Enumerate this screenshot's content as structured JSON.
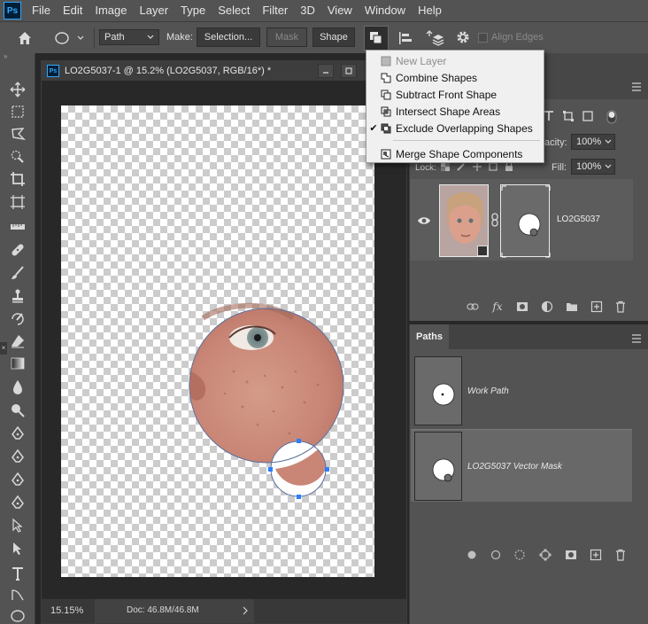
{
  "menubar": {
    "logo": "Ps",
    "items": [
      "File",
      "Edit",
      "Image",
      "Layer",
      "Type",
      "Select",
      "Filter",
      "3D",
      "View",
      "Window",
      "Help"
    ]
  },
  "options": {
    "mode_value": "Path",
    "make_label": "Make:",
    "selection_label": "Selection...",
    "mask_label": "Mask",
    "shape_label": "Shape",
    "align_edges_label": "Align Edges"
  },
  "document": {
    "title": "LO2G5037-1 @ 15.2% (LO2G5037, RGB/16*) *",
    "zoom": "15.15%",
    "doc_size": "Doc: 46.8M/46.8M"
  },
  "dropdown": {
    "items": [
      {
        "label": "New Layer",
        "checked": false,
        "disabled": true,
        "icon": "new-layer-icon"
      },
      {
        "label": "Combine Shapes",
        "checked": false,
        "disabled": false,
        "icon": "combine-shapes-icon"
      },
      {
        "label": "Subtract Front Shape",
        "checked": false,
        "disabled": false,
        "icon": "subtract-front-shape-icon"
      },
      {
        "label": "Intersect Shape Areas",
        "checked": false,
        "disabled": false,
        "icon": "intersect-shape-areas-icon"
      },
      {
        "label": "Exclude Overlapping Shapes",
        "checked": true,
        "disabled": false,
        "icon": "exclude-overlapping-shapes-icon"
      },
      {
        "label": "Merge Shape Components",
        "checked": false,
        "disabled": false,
        "icon": "merge-shape-components-icon"
      }
    ],
    "check_mark": "✔"
  },
  "layers": {
    "opacity_label": "acity:",
    "opacity_value": "100%",
    "lock_label": "Lock:",
    "fill_label": "Fill:",
    "fill_value": "100%",
    "layer_name": "LO2G5037"
  },
  "paths": {
    "tab_label": "Paths",
    "items": [
      {
        "label": "Work Path"
      },
      {
        "label": "LO2G5037 Vector Mask"
      }
    ]
  },
  "colors": {
    "accent": "#31a8ff",
    "ui_bg": "#535353",
    "dark_bg": "#282828"
  }
}
